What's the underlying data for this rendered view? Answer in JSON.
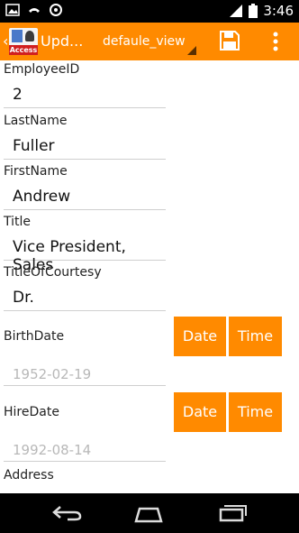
{
  "status_bar": {
    "time": "3:46",
    "icons": [
      "image-icon",
      "voicemail-icon",
      "sync-icon",
      "signal-icon",
      "battery-icon"
    ]
  },
  "action_bar": {
    "logo_word": "Access",
    "title": "Upd...",
    "view_name": "defaule_view",
    "icons": [
      "back-icon",
      "save-icon",
      "overflow-menu-icon"
    ],
    "accent": "#ff8a00"
  },
  "form": {
    "employee_id": {
      "label": "EmployeeID",
      "value": "2"
    },
    "last_name": {
      "label": "LastName",
      "value": "Fuller"
    },
    "first_name": {
      "label": "FirstName",
      "value": "Andrew"
    },
    "title": {
      "label": "Title",
      "value": "Vice President, Sales"
    },
    "title_of_courtesy": {
      "label": "TitleOfCourtesy",
      "value": "Dr."
    },
    "birth_date": {
      "label": "BirthDate",
      "value": "1952-02-19",
      "date_button": "Date",
      "time_button": "Time"
    },
    "hire_date": {
      "label": "HireDate",
      "value": "1992-08-14",
      "date_button": "Date",
      "time_button": "Time"
    },
    "address": {
      "label": "Address"
    }
  },
  "nav_bar": {
    "icons": [
      "back-nav-icon",
      "home-nav-icon",
      "recents-nav-icon"
    ]
  }
}
